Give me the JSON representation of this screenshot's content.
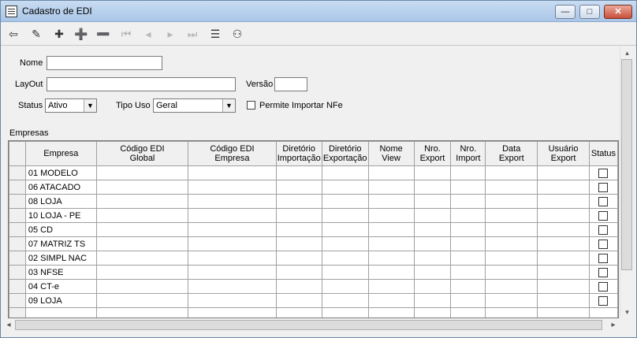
{
  "window": {
    "title": "Cadastro de EDI"
  },
  "titlebar_buttons": {
    "minimize": "—",
    "maximize": "□",
    "close": "✕"
  },
  "toolbar": {
    "tools": [
      {
        "name": "exit-icon",
        "glyph": "⇦",
        "enabled": true
      },
      {
        "name": "edit-icon",
        "glyph": "✎",
        "enabled": true
      },
      {
        "name": "add-icon",
        "glyph": "✚",
        "enabled": true
      },
      {
        "name": "insert-row-icon",
        "glyph": "➕",
        "enabled": false
      },
      {
        "name": "delete-row-icon",
        "glyph": "➖",
        "enabled": false
      },
      {
        "name": "first-icon",
        "glyph": "⏮",
        "enabled": false
      },
      {
        "name": "prev-icon",
        "glyph": "◂",
        "enabled": false
      },
      {
        "name": "next-icon",
        "glyph": "▸",
        "enabled": false
      },
      {
        "name": "last-icon",
        "glyph": "⏭",
        "enabled": false
      },
      {
        "name": "list-icon",
        "glyph": "☰",
        "enabled": true
      },
      {
        "name": "binoculars-icon",
        "glyph": "⚇",
        "enabled": true
      }
    ]
  },
  "form": {
    "nome_label": "Nome",
    "nome_value": "",
    "layout_label": "LayOut",
    "layout_value": "",
    "versao_label": "Versão",
    "versao_value": "",
    "status_label": "Status",
    "status_value": "Ativo",
    "tipo_uso_label": "Tipo Uso",
    "tipo_uso_value": "Geral",
    "permite_label": "Permite Importar NFe"
  },
  "grid": {
    "caption": "Empresas",
    "columns": [
      "Empresa",
      "Código EDI\nGlobal",
      "Código EDI\nEmpresa",
      "Diretório\nImportação",
      "Diretório\nExportação",
      "Nome\nView",
      "Nro.\nExport",
      "Nro.\nImport",
      "Data\nExport",
      "Usuário\nExport",
      "Status"
    ],
    "rows": [
      "01 MODELO",
      "06 ATACADO",
      "08 LOJA",
      "10 LOJA - PE",
      "05 CD",
      "07 MATRIZ TS",
      "02 SIMPL NAC",
      "03 NFSE",
      "04 CT-e",
      "09 LOJA"
    ]
  }
}
